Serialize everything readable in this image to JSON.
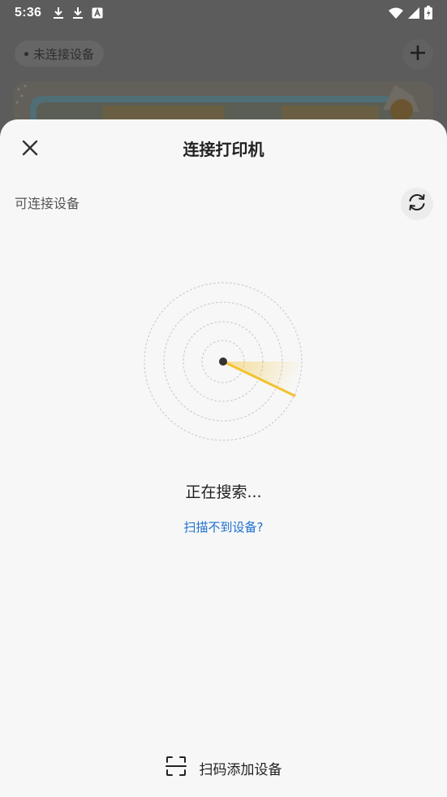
{
  "status_bar": {
    "time": "5:36",
    "left_icons": [
      "download-icon",
      "download-icon",
      "app-notification-icon"
    ],
    "right_icons": [
      "wifi-icon",
      "signal-icon",
      "battery-icon"
    ]
  },
  "background_app": {
    "connection_chip": "未连接设备"
  },
  "sheet": {
    "title": "连接打印机",
    "section_label": "可连接设备",
    "searching_text": "正在搜索...",
    "help_link": "扫描不到设备?",
    "scan_add_label": "扫码添加设备"
  },
  "colors": {
    "accent_yellow": "#f2c230",
    "link_blue": "#1e6fd0",
    "sheet_bg": "#f7f7f7",
    "overlay": "#5c5c5c"
  }
}
